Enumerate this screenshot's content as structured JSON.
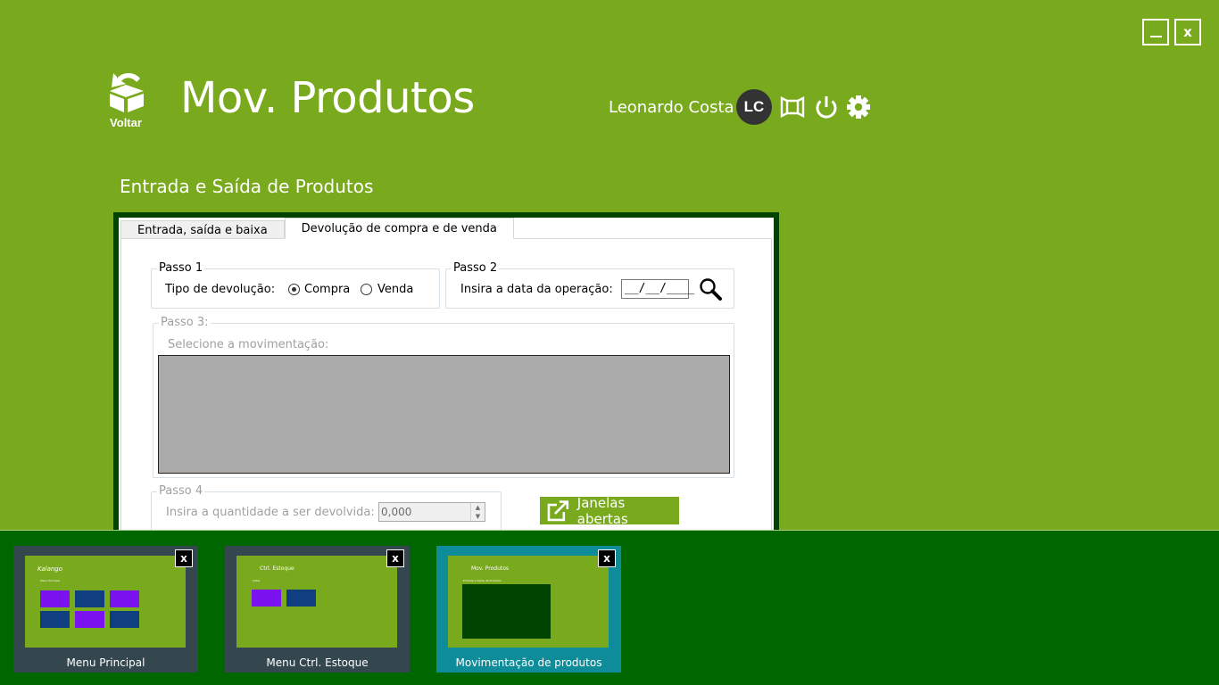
{
  "window": {
    "minimize_label": "_",
    "close_label": "x"
  },
  "header": {
    "back_label": "Voltar",
    "title": "Mov. Produtos",
    "user_name": "Leonardo Costa",
    "user_initials": "LC",
    "icons": [
      "fullscreen-icon",
      "power-icon",
      "gear-icon"
    ]
  },
  "subtitle": "Entrada e Saída de Produtos",
  "form": {
    "tabs": [
      {
        "label": "Entrada, saída e baixa",
        "active": false
      },
      {
        "label": "Devolução de compra e de venda",
        "active": true
      }
    ],
    "step1": {
      "title": "Passo 1",
      "label": "Tipo de devolução:",
      "options": [
        {
          "label": "Compra",
          "checked": true
        },
        {
          "label": "Venda",
          "checked": false
        }
      ]
    },
    "step2": {
      "title": "Passo 2",
      "label": "Insira a data da operação:",
      "date_value": "__/__/____"
    },
    "step3": {
      "title": "Passo 3:",
      "label": "Selecione a movimentação:"
    },
    "step4": {
      "title": "Passo 4",
      "label": "Insira a quantidade a ser devolvida:",
      "quantity_value": "0,000"
    },
    "open_windows_label": "Janelas abertas"
  },
  "taskbar": {
    "windows": [
      {
        "label": "Menu Principal",
        "active": false,
        "mini_title": "Kalango",
        "mini_sub": "Menu Principal"
      },
      {
        "label": "Menu Ctrl. Estoque",
        "active": false,
        "mini_title": "Ctrl. Estoque",
        "mini_sub": "Voltar"
      },
      {
        "label": "Movimentação de produtos",
        "active": true,
        "mini_title": "Mov. Produtos",
        "mini_sub": "Entrada e Saída de Produtos"
      }
    ],
    "close_label": "x"
  },
  "colors": {
    "background": "#79a91c",
    "panel_border": "#004400",
    "taskbar": "#006600",
    "active_thumb": "#0e8c9a",
    "inactive_thumb": "#34474f",
    "tile_purple": "#7b12f0",
    "tile_navy": "#0f3f80"
  }
}
